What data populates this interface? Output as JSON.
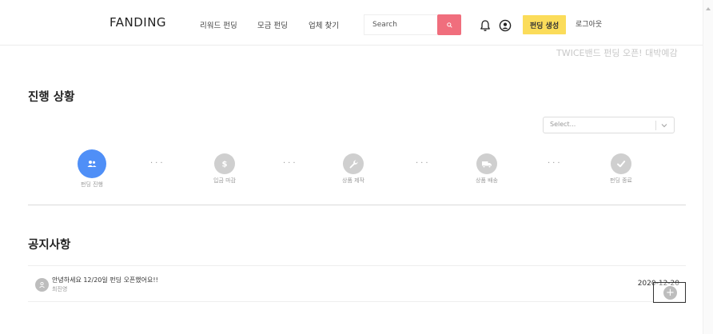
{
  "header": {
    "logo": "FANDING",
    "nav": [
      "리워드 펀딩",
      "모금 펀딩",
      "업체 찾기"
    ],
    "search_placeholder": "Search",
    "create_button": "펀딩 생성",
    "logout": "로그아웃"
  },
  "marquee_text": "TWICE밴드 펀딩 오픈! 대박예감",
  "progress": {
    "title": "진행 상황",
    "select_placeholder": "Select...",
    "steps": [
      {
        "label": "펀딩 진행",
        "icon": "users-icon",
        "active": true
      },
      {
        "label": "입금 마감",
        "icon": "dollar-icon",
        "active": false
      },
      {
        "label": "상품 제작",
        "icon": "wrench-icon",
        "active": false
      },
      {
        "label": "상품 배송",
        "icon": "truck-icon",
        "active": false
      },
      {
        "label": "펀딩 종료",
        "icon": "check-icon",
        "active": false
      }
    ],
    "dots": "..."
  },
  "notices": {
    "title": "공지사항",
    "items": [
      {
        "title": "안녕하세요 12/20일 펀딩 오픈했어요!!",
        "author": "최진영",
        "date": "2020-12-20"
      }
    ]
  },
  "colors": {
    "search_button": "#f06e7d",
    "create_button": "#fbdc5a",
    "active_step": "#4f8ff7",
    "inactive_step": "#cfcfcf"
  }
}
